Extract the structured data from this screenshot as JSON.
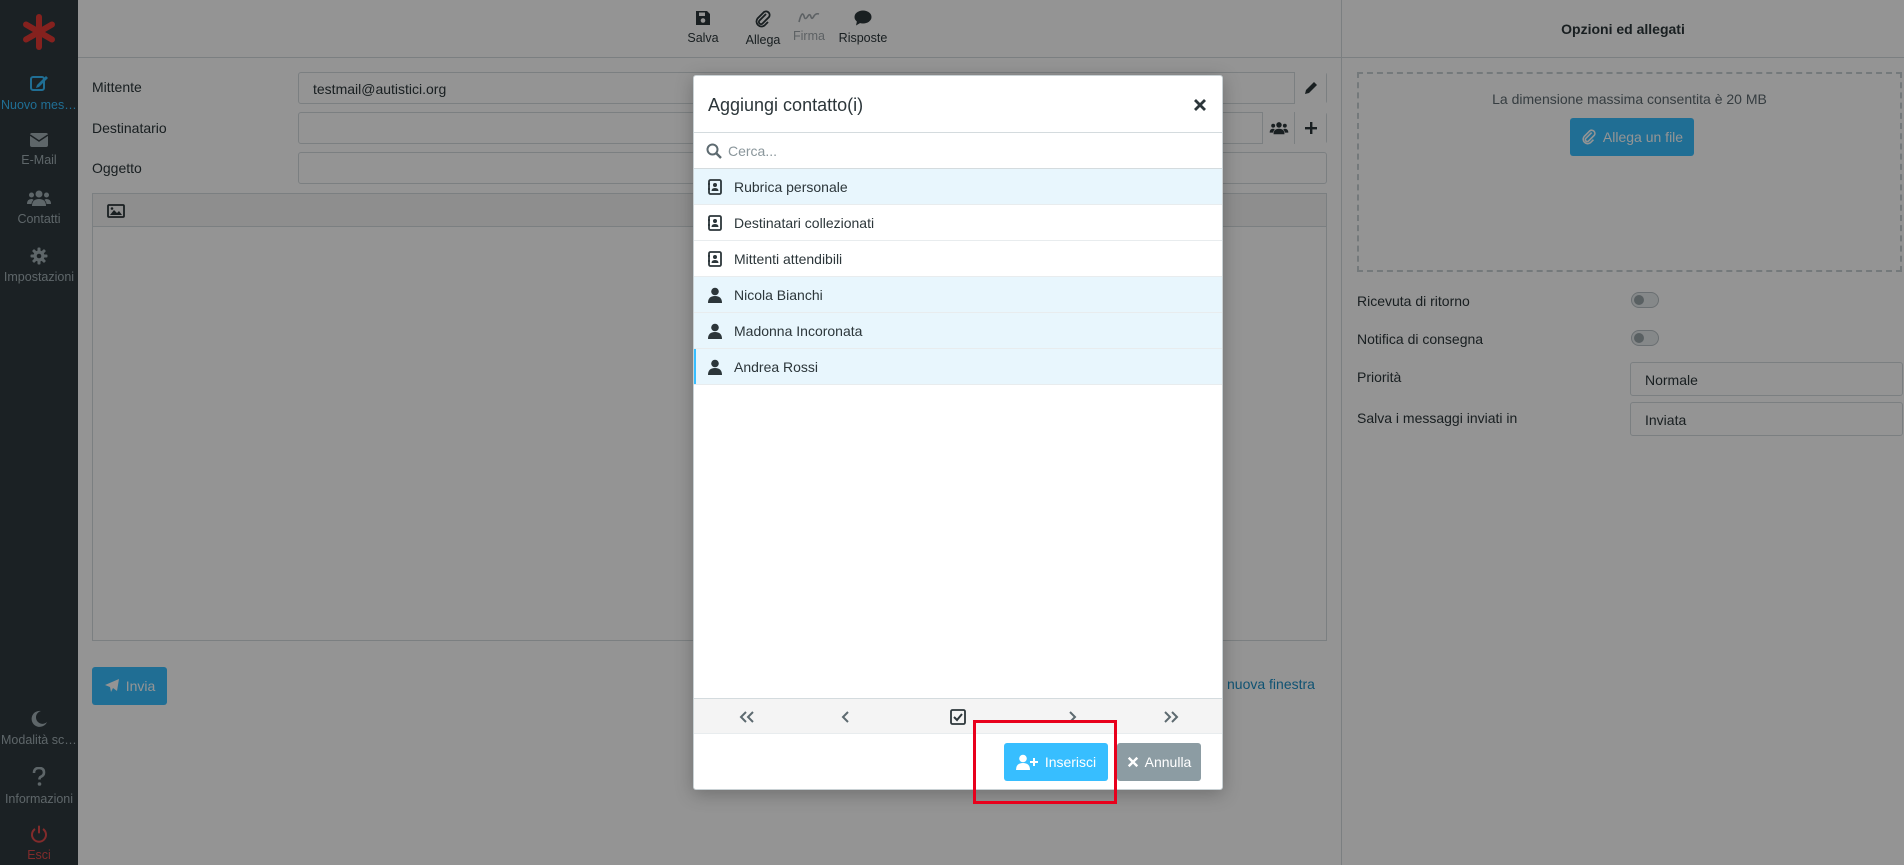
{
  "nav": {
    "items": [
      {
        "label": "Nuovo messaggio",
        "icon": "compose-icon"
      },
      {
        "label": "E-Mail",
        "icon": "envelope-icon"
      },
      {
        "label": "Contatti",
        "icon": "users-icon"
      },
      {
        "label": "Impostazioni",
        "icon": "gear-icon"
      }
    ],
    "bottom": [
      {
        "label": "Modalità scura",
        "icon": "moon-icon"
      },
      {
        "label": "Informazioni",
        "icon": "question-icon"
      },
      {
        "label": "Esci",
        "icon": "power-icon"
      }
    ]
  },
  "toolbar": {
    "save": "Salva",
    "attach": "Allega",
    "signature": "Firma",
    "responses": "Risposte"
  },
  "compose": {
    "from_label": "Mittente",
    "from_value": "testmail@autistici.org",
    "to_label": "Destinatario",
    "subject_label": "Oggetto",
    "send": "Invia",
    "new_window_link": "nuova finestra"
  },
  "options": {
    "title": "Opzioni ed allegati",
    "max_size": "La dimensione massima consentita è 20 MB",
    "attach_button": "Allega un file",
    "return_receipt": "Ricevuta di ritorno",
    "delivery_notice": "Notifica di consegna",
    "priority_label": "Priorità",
    "priority_value": "Normale",
    "save_sent_label": "Salva i messaggi inviati in",
    "save_sent_value": "Inviata"
  },
  "dialog": {
    "title": "Aggiungi contatto(i)",
    "search_placeholder": "Cerca...",
    "rows": [
      {
        "label": "Rubrica personale",
        "icon": "addressbook-icon"
      },
      {
        "label": "Destinatari collezionati",
        "icon": "addressbook-icon"
      },
      {
        "label": "Mittenti attendibili",
        "icon": "addressbook-icon"
      },
      {
        "label": "Nicola Bianchi",
        "icon": "person-icon"
      },
      {
        "label": "Madonna Incoronata",
        "icon": "person-icon"
      },
      {
        "label": "Andrea Rossi",
        "icon": "person-icon"
      }
    ],
    "insert": "Inserisci",
    "cancel": "Annulla"
  },
  "colors": {
    "accent": "#37beff",
    "sidebar": "#2f3a3f",
    "highlight_box": "#e8001c"
  }
}
